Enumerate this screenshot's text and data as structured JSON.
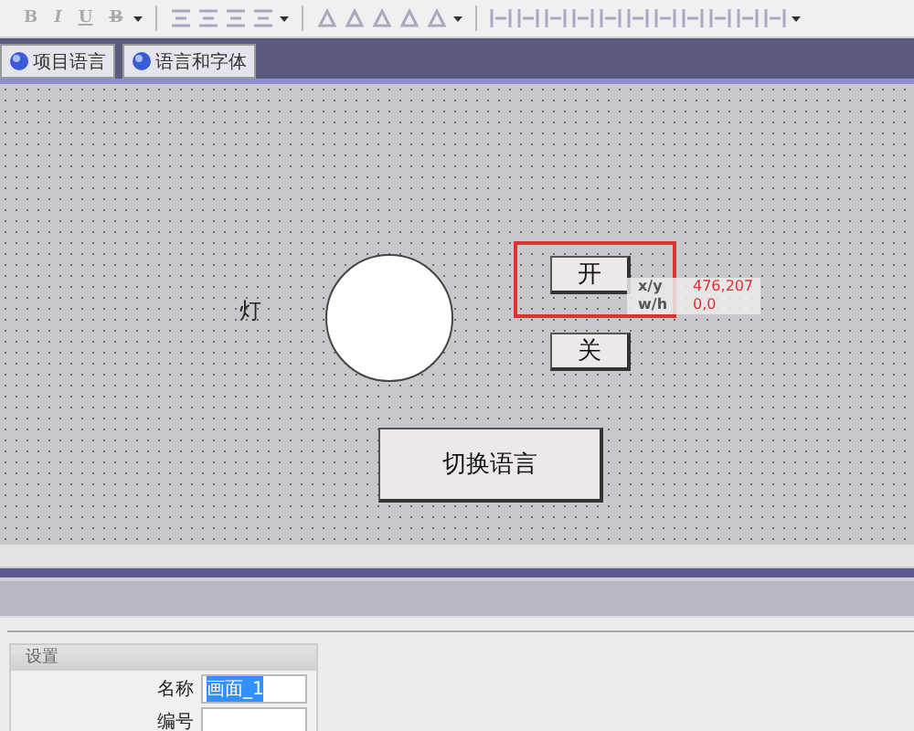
{
  "toolbar": {
    "format_buttons": [
      "B",
      "I",
      "U",
      "B"
    ]
  },
  "tabs": [
    {
      "label": "项目语言",
      "selected": false
    },
    {
      "label": "语言和字体",
      "selected": false
    }
  ],
  "canvas": {
    "lamp_label": "灯",
    "lamp_on": false,
    "buttons": [
      {
        "label": "开",
        "selected": true
      },
      {
        "label": "关",
        "selected": false
      },
      {
        "label": "切换语言",
        "selected": false
      }
    ],
    "position_info": {
      "xy_label": "x/y",
      "xy_value": "476,207",
      "wh_label": "w/h",
      "wh_value": "0,0"
    }
  },
  "properties": {
    "section_title": "设置",
    "fields": [
      {
        "label": "名称",
        "value": "画面_1",
        "kind": "text"
      },
      {
        "label": "编号",
        "kind": "spin"
      }
    ]
  }
}
